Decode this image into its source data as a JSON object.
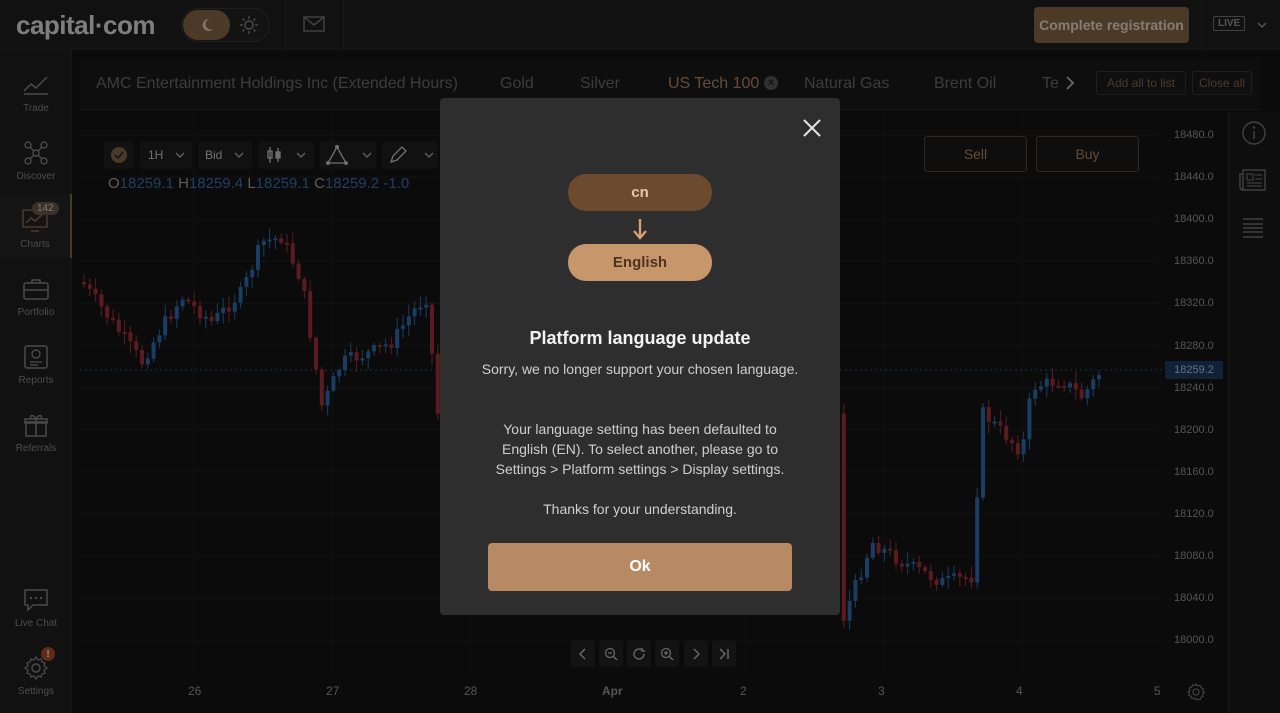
{
  "topbar": {
    "logo": "capital·com",
    "register_label": "Complete registration",
    "live_label": "LIVE"
  },
  "sidebar": {
    "items": [
      {
        "label": "Trade",
        "icon": "trade-icon"
      },
      {
        "label": "Discover",
        "icon": "discover-icon"
      },
      {
        "label": "Charts",
        "icon": "charts-icon",
        "badge": "142"
      },
      {
        "label": "Portfolio",
        "icon": "portfolio-icon"
      },
      {
        "label": "Reports",
        "icon": "reports-icon"
      },
      {
        "label": "Referrals",
        "icon": "gift-icon"
      },
      {
        "label": "Live Chat",
        "icon": "chat-icon"
      },
      {
        "label": "Settings",
        "icon": "gear-icon",
        "alert": "!"
      }
    ]
  },
  "tabs": {
    "items": [
      "AMC Entertainment Holdings Inc (Extended Hours)",
      "Gold",
      "Silver",
      "US Tech 100",
      "Natural Gas",
      "Brent Oil",
      "Te"
    ],
    "active": "US Tech 100",
    "add_all_label": "Add all to list",
    "close_all_label": "Close all"
  },
  "chart_toolbar": {
    "timeframe": "1H",
    "price_type": "Bid"
  },
  "ohlc": {
    "o_label": "O",
    "o": "18259.1",
    "h_label": "H",
    "h": "18259.4",
    "l_label": "L",
    "l": "18259.1",
    "c_label": "C",
    "c": "18259.2",
    "change": "-1.0"
  },
  "trade": {
    "sell_label": "Sell",
    "buy_label": "Buy"
  },
  "axis": {
    "y_ticks": [
      "18480.0",
      "18440.0",
      "18400.0",
      "18360.0",
      "18320.0",
      "18280.0",
      "18240.0",
      "18200.0",
      "18160.0",
      "18120.0",
      "18080.0",
      "18040.0",
      "18000.0"
    ],
    "x_ticks": [
      "26",
      "27",
      "28",
      "Apr",
      "2",
      "3",
      "4",
      "5"
    ],
    "current_price": "18259.2"
  },
  "modal": {
    "from_lang": "cn",
    "to_lang": "English",
    "title": "Platform language update",
    "para1": "Sorry, we no longer support your chosen language.",
    "para2": "Your language setting has been defaulted to English (EN). To select another, please go to Settings > Platform settings > Display settings.",
    "para3": "Thanks for your understanding.",
    "ok_label": "Ok"
  },
  "colors": {
    "accent": "#b88a63",
    "bull": "#2f6fb5",
    "bear": "#a8323c"
  }
}
